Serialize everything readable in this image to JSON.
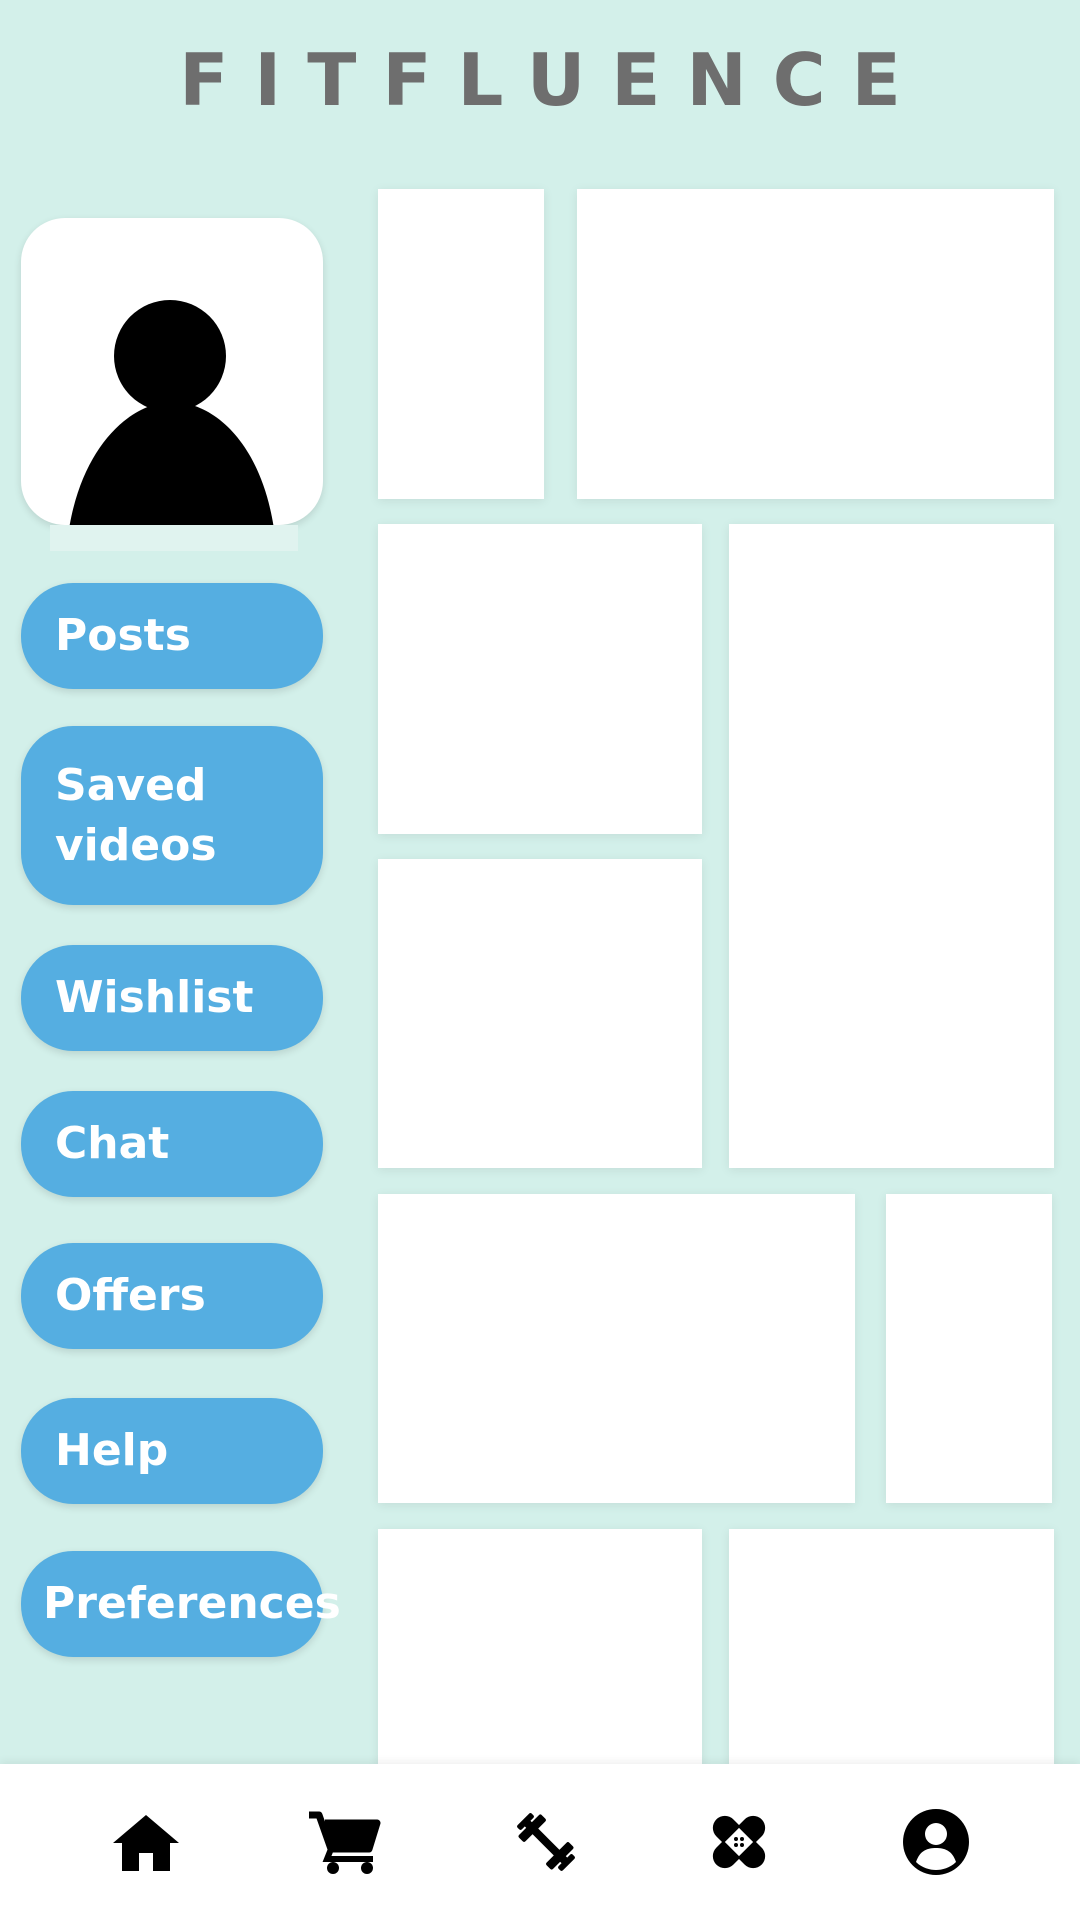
{
  "header": {
    "title": "FITFLUENCE"
  },
  "profile": {
    "avatar_icon": "person-icon"
  },
  "menu": [
    {
      "label": "Posts"
    },
    {
      "label": "Saved\nvideos"
    },
    {
      "label": "Wishlist"
    },
    {
      "label": "Chat"
    },
    {
      "label": "Offers"
    },
    {
      "label": "Help"
    },
    {
      "label": "Preferences"
    }
  ],
  "bottom_nav": [
    {
      "icon": "home-icon"
    },
    {
      "icon": "cart-icon"
    },
    {
      "icon": "dumbbell-icon"
    },
    {
      "icon": "bandage-icon"
    },
    {
      "icon": "account-icon"
    }
  ],
  "colors": {
    "background": "#d3f0ea",
    "button": "#55aee1",
    "title": "#6e6e6e"
  }
}
